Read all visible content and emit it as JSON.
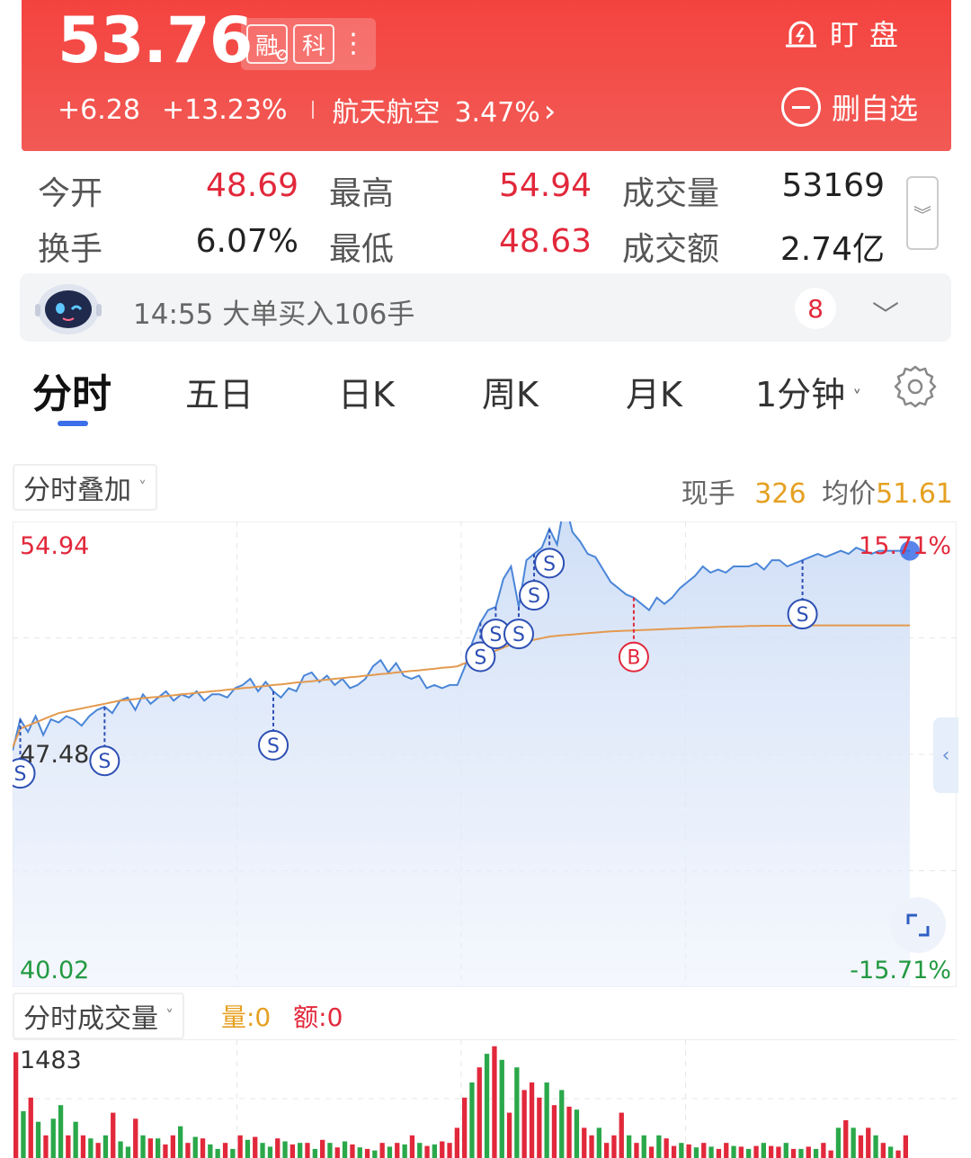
{
  "header": {
    "price": "53.76",
    "tags": [
      "融",
      "科"
    ],
    "more": "⋮",
    "change": "+6.28",
    "change_pct": "+13.23%",
    "sector_name": "航天航空",
    "sector_pct": "3.47%",
    "watch_label": "盯盘",
    "remove_label": "删自选"
  },
  "stats": {
    "open_label": "今开",
    "open_value": "48.69",
    "high_label": "最高",
    "high_value": "54.94",
    "volume_label": "成交量",
    "volume_value": "53169",
    "turnover_label": "换手",
    "turnover_value": "6.07%",
    "low_label": "最低",
    "low_value": "48.63",
    "amount_label": "成交额",
    "amount_value": "2.74亿"
  },
  "ticker": {
    "text": "14:55 大单买入106手",
    "badge": "8"
  },
  "tabs": [
    "分时",
    "五日",
    "日K",
    "周K",
    "月K",
    "1分钟"
  ],
  "overlay": {
    "select_label": "分时叠加",
    "now_label": "现手",
    "now_value": "326",
    "avg_label": "均价",
    "avg_value": "51.61"
  },
  "chart_data": {
    "type": "line",
    "y_top": "54.94",
    "y_mid": "47.48",
    "y_bottom": "40.02",
    "pct_top": "15.71%",
    "pct_bottom": "-15.71%",
    "price_color": "#4a86d8",
    "avg_color": "#e39a4f",
    "price": [
      47.6,
      48.6,
      48.2,
      48.7,
      48.1,
      48.6,
      48.5,
      48.7,
      48.6,
      48.4,
      48.7,
      48.9,
      49.0,
      48.8,
      49.2,
      49.3,
      48.9,
      49.4,
      49.1,
      49.3,
      49.5,
      49.2,
      49.4,
      49.3,
      49.5,
      49.2,
      49.4,
      49.4,
      49.3,
      49.6,
      49.7,
      49.9,
      49.5,
      49.8,
      49.5,
      49.3,
      49.6,
      49.5,
      50.0,
      50.1,
      49.8,
      50.0,
      49.7,
      49.9,
      49.6,
      49.7,
      49.9,
      50.3,
      50.5,
      50.1,
      50.4,
      50.0,
      49.9,
      50.0,
      49.6,
      49.7,
      49.6,
      49.7,
      49.7,
      50.3,
      51.1,
      51.7,
      52.1,
      52.2,
      53.1,
      53.5,
      52.2,
      53.7,
      53.9,
      54.1,
      54.7,
      54.2,
      55.6,
      54.6,
      54.3,
      53.9,
      53.8,
      53.4,
      53.0,
      52.8,
      52.6,
      52.5,
      52.3,
      52.1,
      52.5,
      52.3,
      52.5,
      52.8,
      53.0,
      53.2,
      53.5,
      53.3,
      53.4,
      53.3,
      53.5,
      53.5,
      53.5,
      53.6,
      53.4,
      53.7,
      53.7,
      53.5,
      53.6,
      53.7,
      53.8,
      53.9,
      53.8,
      53.9,
      54.0,
      53.9,
      54.1,
      54.0,
      53.9,
      54.0,
      54.0,
      54.0,
      54.0,
      54.0
    ],
    "avg": [
      47.7,
      48.3,
      48.4,
      48.5,
      48.6,
      48.7,
      48.8,
      48.85,
      48.9,
      48.95,
      49.0,
      49.05,
      49.1,
      49.15,
      49.2,
      49.22,
      49.25,
      49.28,
      49.3,
      49.32,
      49.35,
      49.37,
      49.4,
      49.42,
      49.45,
      49.47,
      49.5,
      49.52,
      49.55,
      49.57,
      49.6,
      49.62,
      49.65,
      49.67,
      49.7,
      49.72,
      49.75,
      49.78,
      49.8,
      49.82,
      49.85,
      49.87,
      49.9,
      49.92,
      49.95,
      49.97,
      50.0,
      50.02,
      50.05,
      50.07,
      50.1,
      50.12,
      50.15,
      50.17,
      50.2,
      50.22,
      50.25,
      50.27,
      50.3,
      50.4,
      50.5,
      50.6,
      50.7,
      50.8,
      50.9,
      51.0,
      51.05,
      51.1,
      51.15,
      51.2,
      51.25,
      51.28,
      51.3,
      51.32,
      51.34,
      51.36,
      51.38,
      51.4,
      51.42,
      51.43,
      51.44,
      51.45,
      51.46,
      51.47,
      51.48,
      51.49,
      51.5,
      51.51,
      51.52,
      51.53,
      51.54,
      51.55,
      51.56,
      51.57,
      51.58,
      51.58,
      51.59,
      51.59,
      51.6,
      51.6,
      51.6,
      51.6,
      51.61,
      51.61,
      51.61,
      51.61,
      51.61,
      51.61,
      51.61,
      51.61,
      51.61,
      51.61,
      51.61,
      51.61,
      51.61,
      51.61,
      51.61,
      51.61
    ],
    "markers": [
      {
        "type": "S",
        "i": 1
      },
      {
        "type": "S",
        "i": 12
      },
      {
        "type": "S",
        "i": 34
      },
      {
        "type": "S",
        "i": 61
      },
      {
        "type": "S",
        "i": 63
      },
      {
        "type": "S",
        "i": 66
      },
      {
        "type": "S",
        "i": 68
      },
      {
        "type": "S",
        "i": 70
      },
      {
        "type": "B",
        "i": 81
      },
      {
        "type": "S",
        "i": 103
      }
    ],
    "xlim": [
      0,
      119
    ],
    "ylim": [
      40.02,
      54.94
    ]
  },
  "volume": {
    "select_label": "分时成交量",
    "qty_label": "量:0",
    "amt_label": "额:0",
    "max_label": "1483",
    "up_color": "#e2283b",
    "down_color": "#2aa84a",
    "bars": [
      1400,
      620,
      800,
      480,
      300,
      520,
      700,
      300,
      480,
      300,
      260,
      200,
      300,
      600,
      220,
      150,
      520,
      300,
      260,
      260,
      180,
      300,
      420,
      200,
      280,
      260,
      180,
      120,
      200,
      120,
      300,
      240,
      280,
      200,
      150,
      260,
      220,
      180,
      200,
      200,
      120,
      240,
      200,
      140,
      220,
      180,
      140,
      120,
      100,
      200,
      150,
      200,
      180,
      300,
      200,
      160,
      180,
      220,
      200,
      400,
      800,
      1000,
      1200,
      1380,
      1480,
      1300,
      600,
      1200,
      900,
      1000,
      800,
      1000,
      700,
      900,
      680,
      640,
      400,
      300,
      400,
      200,
      300,
      600,
      300,
      200,
      300,
      150,
      300,
      260,
      160,
      200,
      180,
      140,
      200,
      150,
      120,
      200,
      160,
      150,
      120,
      160,
      200,
      160,
      150,
      200,
      120,
      120,
      150,
      120,
      200,
      100,
      400,
      500,
      400,
      300,
      400,
      300,
      200,
      150,
      100,
      300
    ],
    "up": [
      1,
      0,
      1,
      0,
      1,
      0,
      0,
      1,
      0,
      1,
      0,
      1,
      0,
      1,
      0,
      0,
      1,
      0,
      1,
      0,
      1,
      1,
      0,
      1,
      0,
      1,
      0,
      0,
      1,
      0,
      1,
      0,
      1,
      0,
      0,
      1,
      0,
      1,
      0,
      1,
      0,
      1,
      0,
      1,
      0,
      1,
      0,
      1,
      0,
      1,
      0,
      1,
      0,
      1,
      0,
      1,
      0,
      1,
      1,
      1,
      1,
      0,
      1,
      0,
      1,
      0,
      1,
      0,
      1,
      1,
      1,
      0,
      1,
      0,
      1,
      0,
      1,
      1,
      0,
      1,
      1,
      1,
      0,
      1,
      0,
      1,
      0,
      1,
      1,
      0,
      1,
      0,
      1,
      0,
      1,
      1,
      0,
      1,
      0,
      1,
      0,
      1,
      1,
      0,
      1,
      0,
      1,
      0,
      1,
      1,
      0,
      1,
      0,
      1,
      1,
      0,
      1,
      0,
      1,
      1
    ]
  }
}
